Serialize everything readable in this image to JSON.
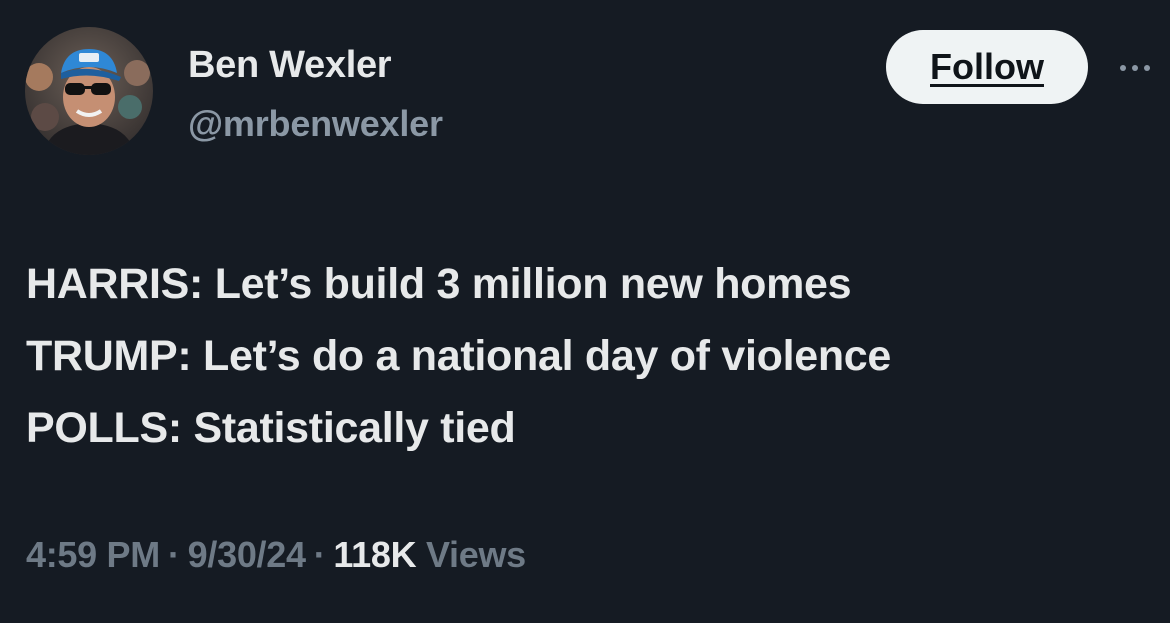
{
  "author": {
    "name": "Ben Wexler",
    "handle": "@mrbenwexler"
  },
  "follow_label": "Follow",
  "more_icon": "more-horizontal-icon",
  "tweet_lines": [
    "HARRIS: Let’s build 3 million new homes",
    "TRUMP: Let’s do a national day of violence",
    "POLLS: Statistically tied"
  ],
  "meta": {
    "time": "4:59 PM",
    "separator": "·",
    "date": "9/30/24",
    "views_count": "118K",
    "views_label": "Views"
  },
  "colors": {
    "background": "#151b23",
    "text_primary": "#e7e9ea",
    "text_secondary": "#8b98a5",
    "button_bg": "#eff3f4"
  }
}
